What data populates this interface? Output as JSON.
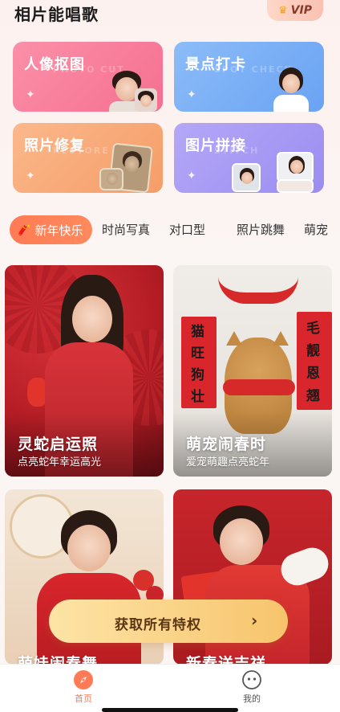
{
  "app": {
    "title": "相片能唱歌"
  },
  "vip": {
    "label": "VIP",
    "icon": "crown-icon"
  },
  "features": [
    {
      "label": "人像抠图",
      "color": "#f9809d"
    },
    {
      "label": "景点打卡",
      "color": "#7bb1f6"
    },
    {
      "label": "照片修复",
      "color": "#f7a977"
    },
    {
      "label": "图片拼接",
      "color": "#a99cf4"
    }
  ],
  "tabs": [
    {
      "label": "新年快乐",
      "active": true,
      "icon": "firecracker-icon"
    },
    {
      "label": "时尚写真"
    },
    {
      "label": "对口型"
    },
    {
      "label": "照片跳舞"
    },
    {
      "label": "萌宠"
    }
  ],
  "cards": [
    {
      "title": "灵蛇启运照",
      "subtitle": "点亮蛇年幸运高光"
    },
    {
      "title": "萌宠闹春时",
      "subtitle": "爱宠萌趣点亮蛇年"
    },
    {
      "title": "萌娃闹春舞",
      "subtitle": ""
    },
    {
      "title": "新春送吉祥",
      "subtitle": ""
    }
  ],
  "couplet": {
    "left": [
      "猫",
      "旺",
      "狗",
      "壮"
    ],
    "right": [
      "毛",
      "靓",
      "恩",
      "翘"
    ]
  },
  "cta": {
    "label": "获取所有特权",
    "arrow": "›"
  },
  "nav": [
    {
      "label": "首页",
      "active": true,
      "icon": "compass-icon"
    },
    {
      "label": "我的",
      "active": false,
      "icon": "profile-face-icon"
    }
  ],
  "colors": {
    "accent": "#ff7b55",
    "cta_start": "#fde4a6",
    "cta_end": "#f7c46c"
  }
}
